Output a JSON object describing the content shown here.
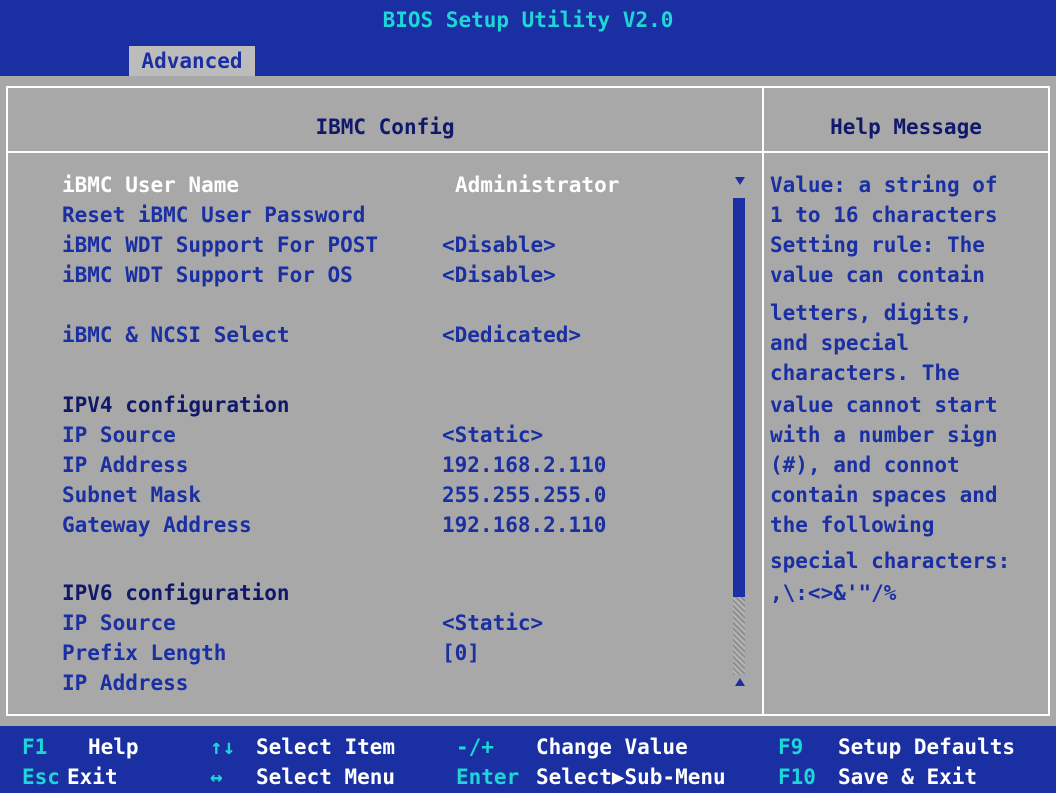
{
  "app": {
    "title": "BIOS Setup Utility V2.0",
    "active_tab": "Advanced"
  },
  "section": {
    "title": "IBMC Config"
  },
  "settings": {
    "rows": [
      {
        "label": "iBMC User Name",
        "value": "Administrator",
        "selected": true
      },
      {
        "label": "Reset iBMC User Password",
        "value": ""
      },
      {
        "label": "iBMC WDT Support For POST",
        "value": "<Disable>"
      },
      {
        "label": "iBMC WDT Support For OS",
        "value": "<Disable>"
      },
      {
        "label": "iBMC & NCSI Select",
        "value": "<Dedicated>"
      },
      {
        "label": "IPV4 configuration",
        "value": "",
        "heading": true
      },
      {
        "label": "IP Source",
        "value": "<Static>"
      },
      {
        "label": "IP Address",
        "value": "192.168.2.110"
      },
      {
        "label": "Subnet Mask",
        "value": "255.255.255.0"
      },
      {
        "label": "Gateway Address",
        "value": "192.168.2.110"
      },
      {
        "label": "IPV6 configuration",
        "value": "",
        "heading": true
      },
      {
        "label": "IP Source",
        "value": "<Static>"
      },
      {
        "label": "Prefix Length",
        "value": "[0]"
      },
      {
        "label": "IP Address",
        "value": ""
      }
    ]
  },
  "help": {
    "header": "Help Message",
    "lines": [
      "Value: a string of",
      "1 to 16 characters",
      "Setting rule: The",
      "value can contain",
      "letters, digits,",
      "and special",
      "characters. The",
      "value cannot start",
      "with a number sign",
      "(#), and connot",
      "contain spaces and",
      "the following",
      "special characters:",
      ",\\:<>&'\"/%"
    ]
  },
  "footer": {
    "items": [
      {
        "key": "F1",
        "label": "Help"
      },
      {
        "key": "↑↓",
        "label": "Select Item"
      },
      {
        "key": "-/+",
        "label": "Change Value"
      },
      {
        "key": "F9",
        "label": "Setup Defaults"
      },
      {
        "key": "Esc",
        "label": "Exit"
      },
      {
        "key": "↔",
        "label": "Select Menu"
      },
      {
        "key": "Enter",
        "label": "Select▶Sub-Menu"
      },
      {
        "key": "F10",
        "label": "Save & Exit"
      }
    ]
  },
  "colors": {
    "background": "#a8a8a8",
    "title_bar": "#1a2fa2",
    "accent": "#1fd6d6",
    "text": "#1a2fa2",
    "selected_text": "#ffffff"
  }
}
